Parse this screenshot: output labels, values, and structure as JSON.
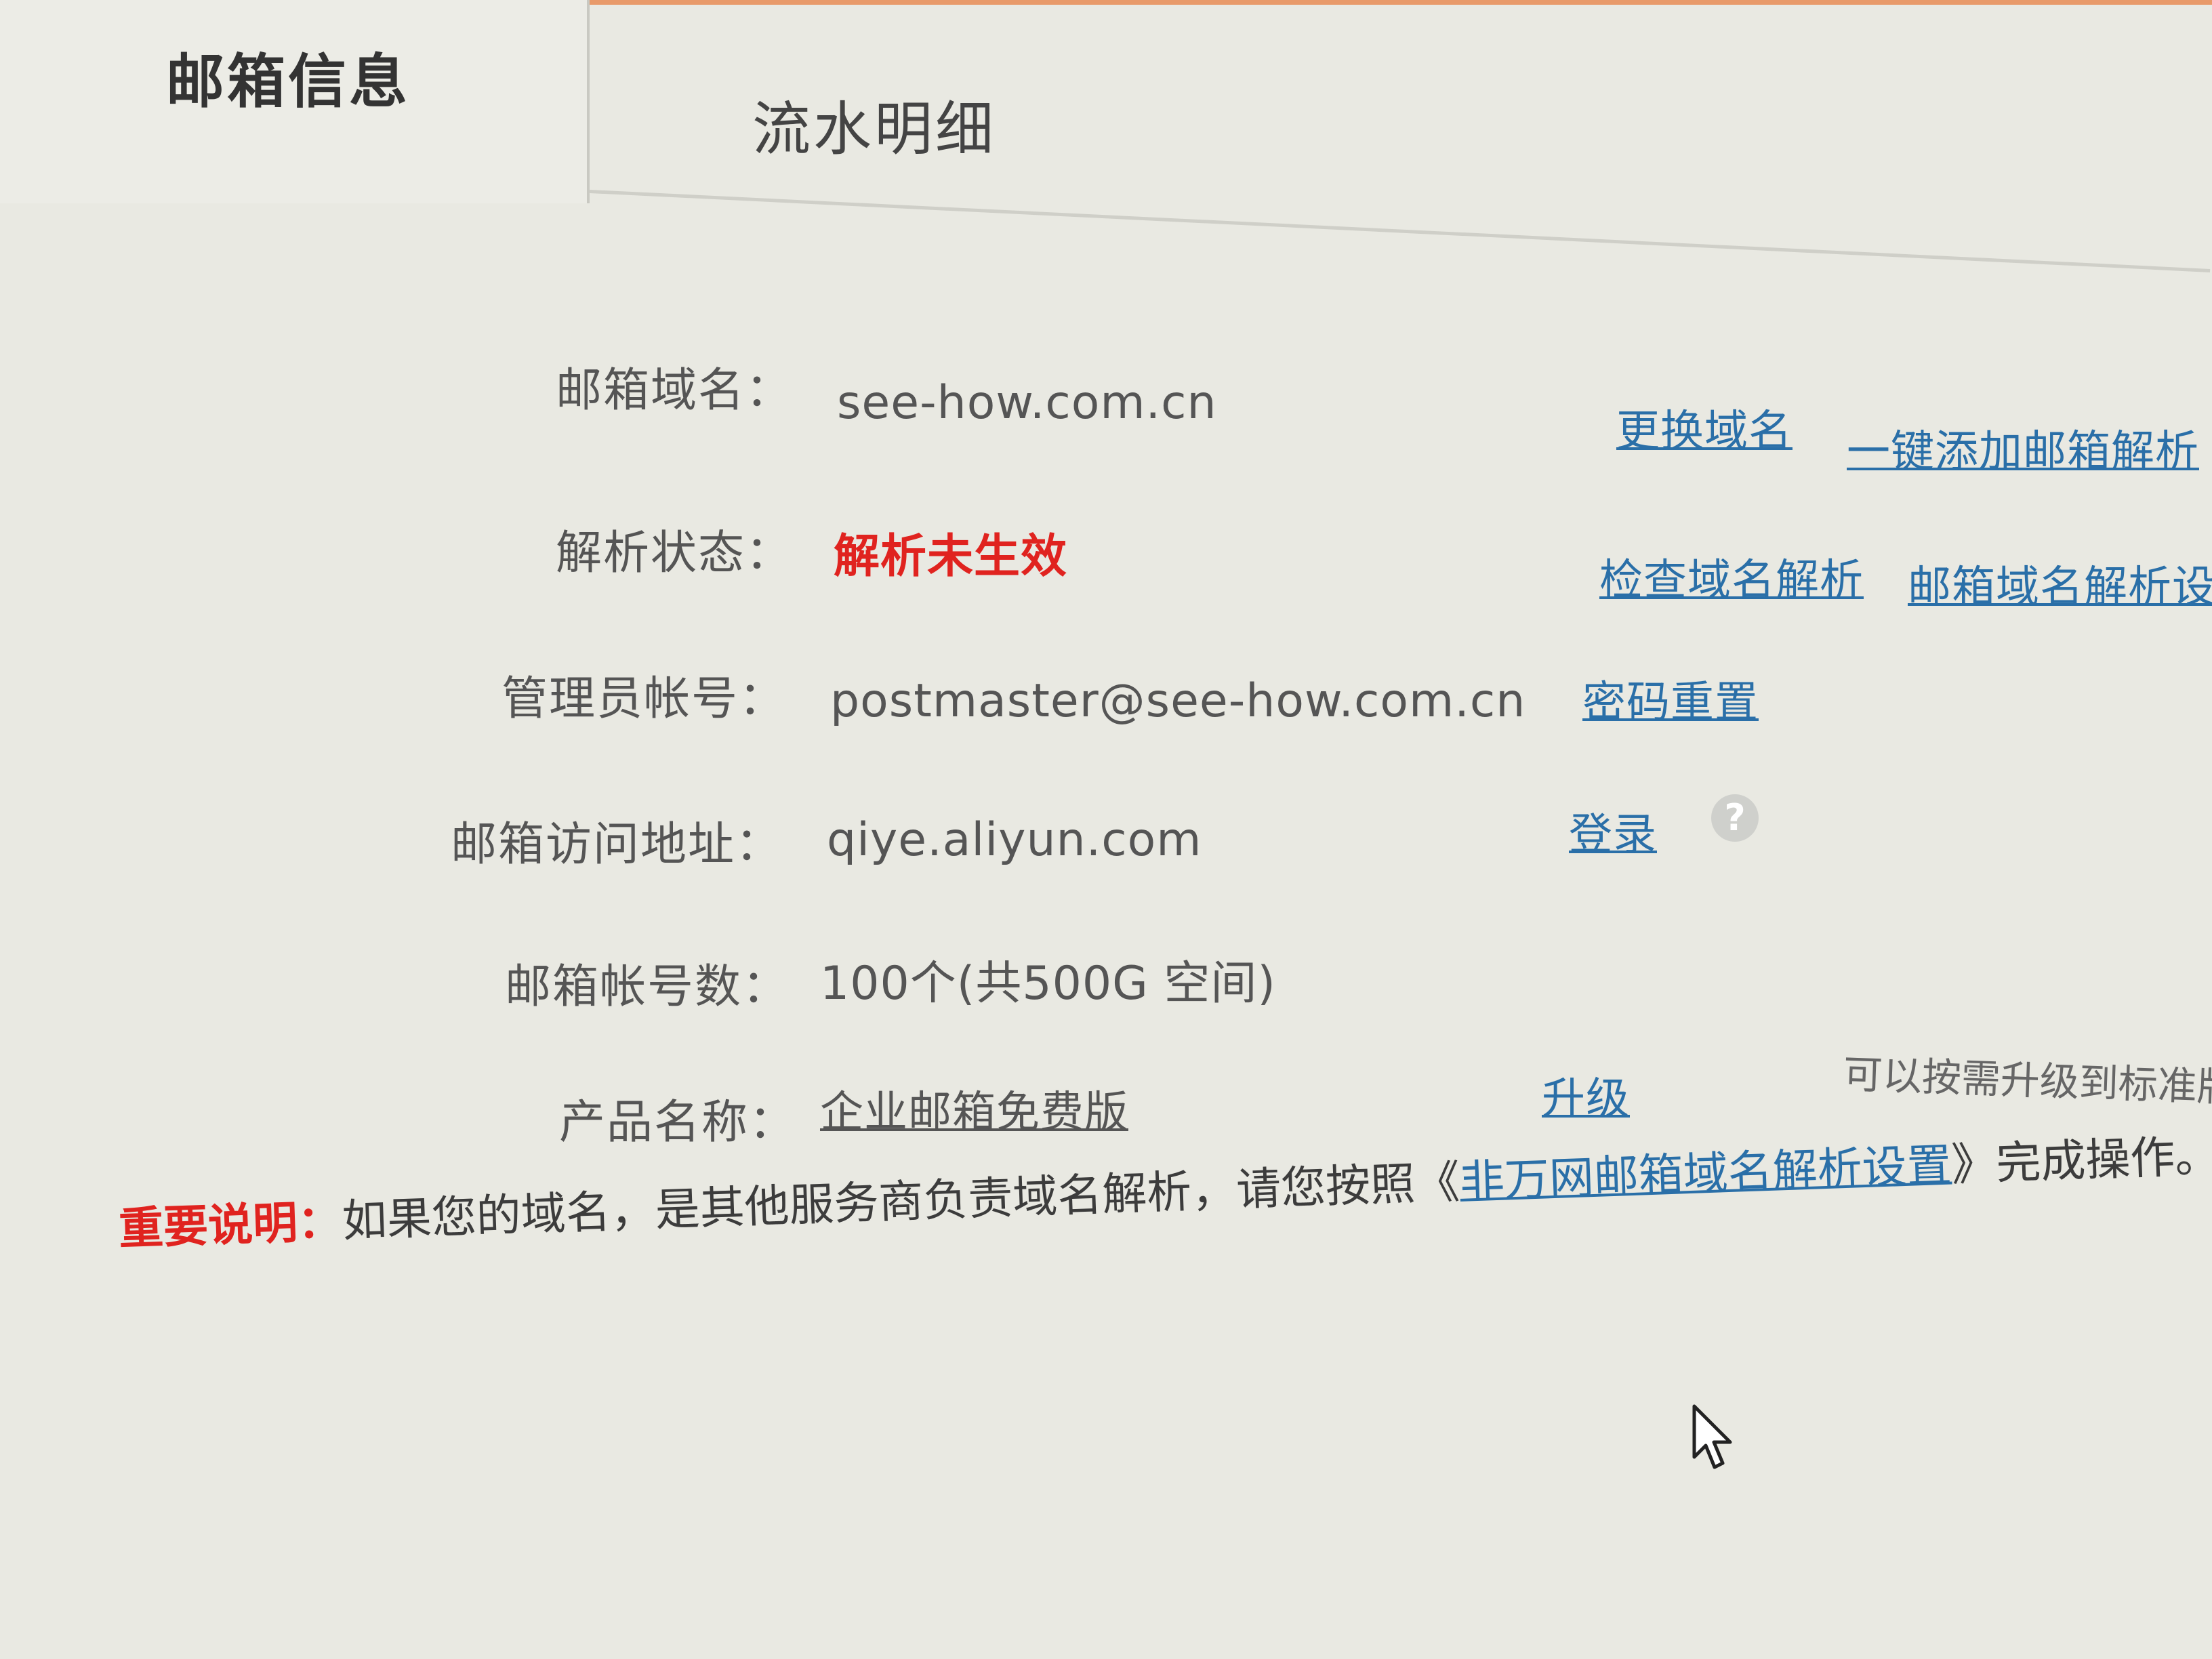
{
  "tabs": [
    {
      "label": "邮箱信息",
      "active": true
    },
    {
      "label": "流水明细",
      "active": false
    }
  ],
  "fields": {
    "domain": {
      "label": "邮箱域名：",
      "value": "see-how.com.cn",
      "links": [
        "更换域名",
        "一键添加邮箱解析"
      ]
    },
    "dns_status": {
      "label": "解析状态：",
      "value": "解析未生效",
      "links": [
        "检查域名解析",
        "邮箱域名解析设置"
      ]
    },
    "admin": {
      "label": "管理员帐号：",
      "value": "postmaster@see-how.com.cn",
      "links": [
        "密码重置"
      ]
    },
    "access": {
      "label": "邮箱访问地址：",
      "value": "qiye.aliyun.com",
      "links": [
        "登录"
      ],
      "help": "?"
    },
    "accounts": {
      "label": "邮箱帐号数：",
      "value": "100个(共500G 空间)"
    },
    "product": {
      "label": "产品名称：",
      "value": "企业邮箱免费版",
      "links": [
        "升级"
      ],
      "hint": "可以按需升级到标准版"
    }
  },
  "note": {
    "title": "重要说明：",
    "text_before": "如果您的域名，是其他服务商负责域名解析，请您按照《",
    "link": "非万网邮箱域名解析设置",
    "text_after": "》完成操作。"
  },
  "colors": {
    "status_error": "#e0231f",
    "link": "#2a6fa8",
    "tab_border": "#e89a6a"
  }
}
